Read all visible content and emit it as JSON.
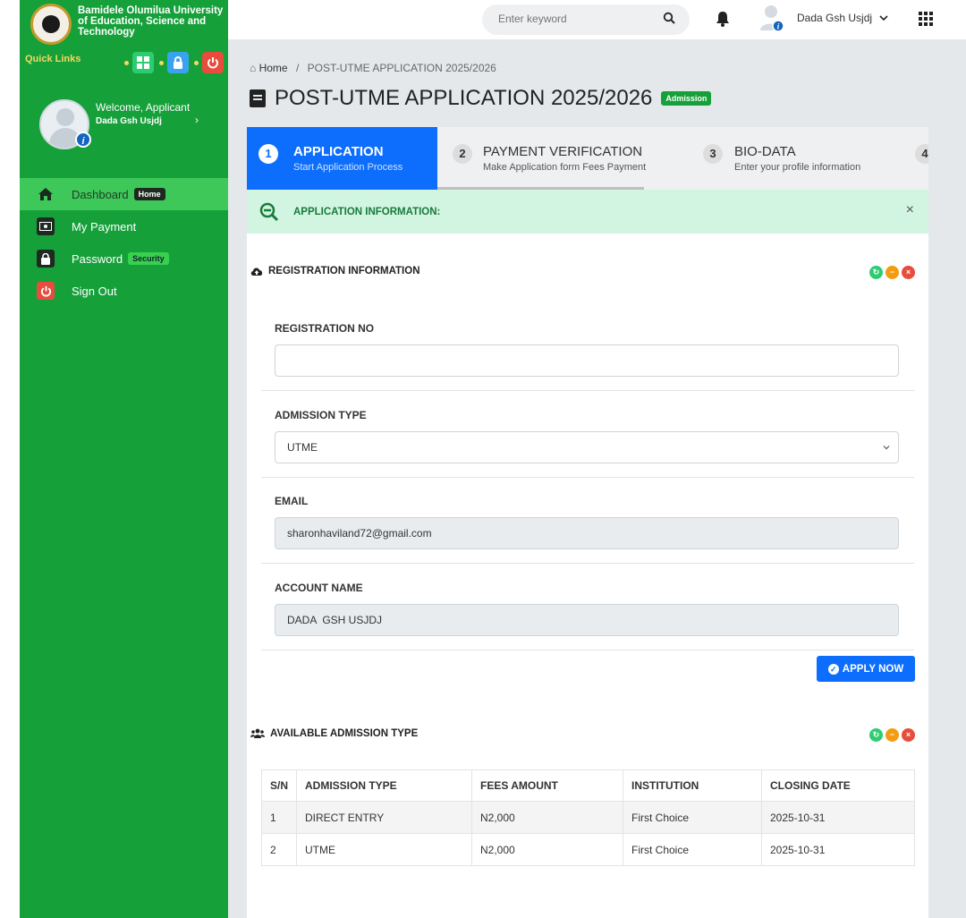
{
  "sidebar": {
    "brand_name": "Bamidele Olumilua University of Education, Science and Technology",
    "quick_links": "Quick Links",
    "welcome": "Welcome, Applicant",
    "user_name": "Dada Gsh Usjdj",
    "items": [
      {
        "label": "Dashboard",
        "badge": "Home"
      },
      {
        "label": "My Payment",
        "badge": ""
      },
      {
        "label": "Password",
        "badge": "Security"
      },
      {
        "label": "Sign Out",
        "badge": ""
      }
    ]
  },
  "topbar": {
    "search_placeholder": "Enter keyword",
    "user_name": "Dada Gsh Usjdj"
  },
  "breadcrumb": {
    "home": "Home",
    "separator": "/",
    "current": "POST-UTME APPLICATION 2025/2026"
  },
  "page": {
    "title": "POST-UTME APPLICATION 2025/2026",
    "badge": "Admission"
  },
  "steps": [
    {
      "num": "1",
      "title": "APPLICATION",
      "sub": "Start Application Process"
    },
    {
      "num": "2",
      "title": "PAYMENT VERIFICATION",
      "sub": "Make Application form Fees Payment"
    },
    {
      "num": "3",
      "title": "BIO-DATA",
      "sub": "Enter your profile information"
    },
    {
      "num": "4",
      "title": "",
      "sub": ""
    }
  ],
  "alert": {
    "text": "APPLICATION INFORMATION:",
    "close": "×"
  },
  "registration": {
    "heading": "REGISTRATION INFORMATION",
    "reg_no_label": "REGISTRATION NO",
    "reg_no_value": "",
    "admission_type_label": "ADMISSION TYPE",
    "admission_type_value": "UTME",
    "email_label": "EMAIL",
    "email_value": "sharonhaviland72@gmail.com",
    "account_name_label": "ACCOUNT NAME",
    "account_name_value": "DADA  GSH USJDJ",
    "apply_label": "APPLY NOW"
  },
  "available": {
    "heading": "AVAILABLE ADMISSION TYPE",
    "columns": [
      "S/N",
      "ADMISSION TYPE",
      "FEES AMOUNT",
      "INSTITUTION",
      "CLOSING DATE"
    ],
    "rows": [
      [
        "1",
        "DIRECT ENTRY",
        "N2,000",
        "First Choice",
        "2025-10-31"
      ],
      [
        "2",
        "UTME",
        "N2,000",
        "First Choice",
        "2025-10-31"
      ]
    ]
  },
  "colors": {
    "sidebar_green": "#16a03a",
    "primary_blue": "#0d6efd",
    "alert_bg": "#d1f5e0"
  },
  "icons": [
    "university-logo",
    "grid-icon",
    "lock-icon",
    "power-icon",
    "home-icon",
    "money-icon",
    "search-icon",
    "bell-icon",
    "apps-grid-icon",
    "cloud-upload-icon",
    "users-icon",
    "zoom-out-icon",
    "check-circle-icon"
  ]
}
